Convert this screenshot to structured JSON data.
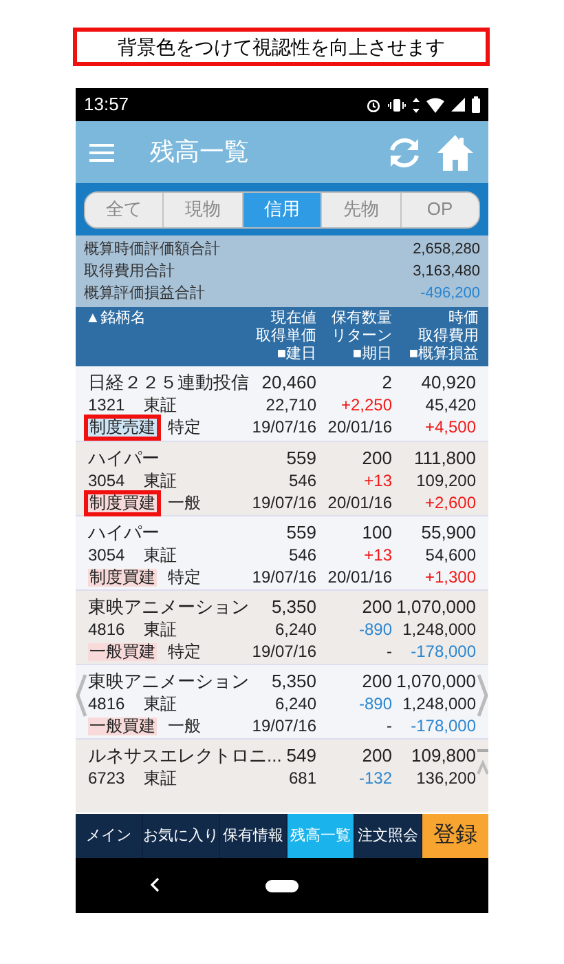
{
  "caption": "背景色をつけて視認性を向上させます",
  "status_bar": {
    "time": "13:57"
  },
  "header": {
    "title": "残高一覧"
  },
  "tabs": [
    {
      "label": "全て",
      "selected": false
    },
    {
      "label": "現物",
      "selected": false
    },
    {
      "label": "信用",
      "selected": true
    },
    {
      "label": "先物",
      "selected": false
    },
    {
      "label": "OP",
      "selected": false
    }
  ],
  "summary": [
    {
      "label": "概算時価評価額合計",
      "value": {
        "text": "2,658,280",
        "color": "#222222"
      }
    },
    {
      "label": "取得費用合計",
      "value": {
        "text": "3,163,480",
        "color": "#222222"
      }
    },
    {
      "label": "概算評価損益合計",
      "value": {
        "text": "-496,200",
        "color": "#2a86d0"
      }
    }
  ],
  "columns": [
    [
      "▲銘柄名"
    ],
    [
      "現在値",
      "取得単価",
      "■建日"
    ],
    [
      "保有数量",
      "リターン",
      "■期日"
    ],
    [
      "時価",
      "取得費用",
      "■概算損益"
    ]
  ],
  "rows": [
    {
      "name": "日経２２５連動投信",
      "price": "20,460",
      "quantity": "2",
      "market_value": "40,920",
      "code": "1321",
      "market": "東証",
      "unit_cost": "22,710",
      "return": {
        "text": "+2,250",
        "color": "#f01818"
      },
      "cost": "45,420",
      "tag": {
        "text": "制度売建",
        "color": "#cfe5f6",
        "highlighted": true
      },
      "account": "特定",
      "open_date": "19/07/16",
      "due_date": "20/01/16",
      "profit": {
        "text": "+4,500",
        "color": "#f01818"
      }
    },
    {
      "name": "ハイパー",
      "price": "559",
      "quantity": "200",
      "market_value": "111,800",
      "code": "3054",
      "market": "東証",
      "unit_cost": "546",
      "return": {
        "text": "+13",
        "color": "#f01818"
      },
      "cost": "109,200",
      "tag": {
        "text": "制度買建",
        "color": "#f9dada",
        "highlighted": true
      },
      "account": "一般",
      "open_date": "19/07/16",
      "due_date": "20/01/16",
      "profit": {
        "text": "+2,600",
        "color": "#f01818"
      }
    },
    {
      "name": "ハイパー",
      "price": "559",
      "quantity": "100",
      "market_value": "55,900",
      "code": "3054",
      "market": "東証",
      "unit_cost": "546",
      "return": {
        "text": "+13",
        "color": "#f01818"
      },
      "cost": "54,600",
      "tag": {
        "text": "制度買建",
        "color": "#f9dada",
        "highlighted": false
      },
      "account": "特定",
      "open_date": "19/07/16",
      "due_date": "20/01/16",
      "profit": {
        "text": "+1,300",
        "color": "#f01818"
      }
    },
    {
      "name": "東映アニメーション",
      "price": "5,350",
      "quantity": "200",
      "market_value": "1,070,000",
      "code": "4816",
      "market": "東証",
      "unit_cost": "6,240",
      "return": {
        "text": "-890",
        "color": "#2a86d0"
      },
      "cost": "1,248,000",
      "tag": {
        "text": "一般買建",
        "color": "#f9dada",
        "highlighted": false
      },
      "account": "特定",
      "open_date": "19/07/16",
      "due_date": "-",
      "profit": {
        "text": "-178,000",
        "color": "#2a86d0"
      }
    },
    {
      "name": "東映アニメーション",
      "price": "5,350",
      "quantity": "200",
      "market_value": "1,070,000",
      "code": "4816",
      "market": "東証",
      "unit_cost": "6,240",
      "return": {
        "text": "-890",
        "color": "#2a86d0"
      },
      "cost": "1,248,000",
      "tag": {
        "text": "一般買建",
        "color": "#f9dada",
        "highlighted": false
      },
      "account": "一般",
      "open_date": "19/07/16",
      "due_date": "-",
      "profit": {
        "text": "-178,000",
        "color": "#2a86d0"
      }
    },
    {
      "name": "ルネサスエレクトロニ...",
      "price": "549",
      "quantity": "200",
      "market_value": "109,800",
      "code": "6723",
      "market": "東証",
      "unit_cost": "681",
      "return": {
        "text": "-132",
        "color": "#2a86d0"
      },
      "cost": "136,200"
    }
  ],
  "bottom_nav": [
    {
      "label": "メイン",
      "selected": false
    },
    {
      "label": "お気に入り",
      "selected": false
    },
    {
      "label": "保有情報",
      "selected": false
    },
    {
      "label": "残高一覧",
      "selected": true
    },
    {
      "label": "注文照会",
      "selected": false
    }
  ],
  "register_button": "登録"
}
